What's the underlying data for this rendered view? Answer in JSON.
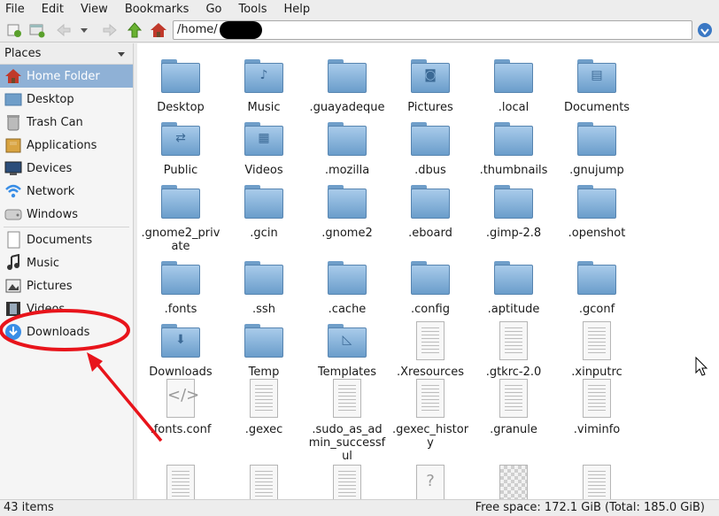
{
  "menubar": {
    "items": [
      "File",
      "Edit",
      "View",
      "Bookmarks",
      "Go",
      "Tools",
      "Help"
    ]
  },
  "toolbar": {
    "path": "/home/"
  },
  "sidebar": {
    "header": "Places",
    "group1": [
      {
        "label": "Home Folder",
        "icon": "home-icon",
        "selected": true
      },
      {
        "label": "Desktop",
        "icon": "desktop-icon"
      },
      {
        "label": "Trash Can",
        "icon": "trash-icon"
      },
      {
        "label": "Applications",
        "icon": "applications-icon"
      },
      {
        "label": "Devices",
        "icon": "devices-icon"
      },
      {
        "label": "Network",
        "icon": "network-icon"
      },
      {
        "label": "Windows",
        "icon": "drive-icon"
      }
    ],
    "group2": [
      {
        "label": "Documents",
        "icon": "document-icon"
      },
      {
        "label": "Music",
        "icon": "music-icon"
      },
      {
        "label": "Pictures",
        "icon": "pictures-icon"
      },
      {
        "label": "Videos",
        "icon": "videos-icon"
      },
      {
        "label": "Downloads",
        "icon": "downloads-icon"
      }
    ]
  },
  "files": [
    {
      "name": "Desktop",
      "kind": "folder",
      "emblem": ""
    },
    {
      "name": "Music",
      "kind": "folder",
      "emblem": "♪"
    },
    {
      "name": ".guayadeque",
      "kind": "folder",
      "emblem": ""
    },
    {
      "name": "Pictures",
      "kind": "folder",
      "emblem": "◙"
    },
    {
      "name": ".local",
      "kind": "folder",
      "emblem": ""
    },
    {
      "name": "Documents",
      "kind": "folder",
      "emblem": "▤"
    },
    {
      "name": "Public",
      "kind": "folder",
      "emblem": "⇄"
    },
    {
      "name": "Videos",
      "kind": "folder",
      "emblem": "▦"
    },
    {
      "name": ".mozilla",
      "kind": "folder",
      "emblem": ""
    },
    {
      "name": ".dbus",
      "kind": "folder",
      "emblem": ""
    },
    {
      "name": ".thumbnails",
      "kind": "folder",
      "emblem": ""
    },
    {
      "name": ".gnujump",
      "kind": "folder",
      "emblem": ""
    },
    {
      "name": ".gnome2_private",
      "kind": "folder",
      "emblem": ""
    },
    {
      "name": ".gcin",
      "kind": "folder",
      "emblem": ""
    },
    {
      "name": ".gnome2",
      "kind": "folder",
      "emblem": ""
    },
    {
      "name": ".eboard",
      "kind": "folder",
      "emblem": ""
    },
    {
      "name": ".gimp-2.8",
      "kind": "folder",
      "emblem": ""
    },
    {
      "name": ".openshot",
      "kind": "folder",
      "emblem": ""
    },
    {
      "name": ".fonts",
      "kind": "folder",
      "emblem": ""
    },
    {
      "name": ".ssh",
      "kind": "folder",
      "emblem": ""
    },
    {
      "name": ".cache",
      "kind": "folder",
      "emblem": ""
    },
    {
      "name": ".config",
      "kind": "folder",
      "emblem": ""
    },
    {
      "name": ".aptitude",
      "kind": "folder",
      "emblem": ""
    },
    {
      "name": ".gconf",
      "kind": "folder",
      "emblem": ""
    },
    {
      "name": "Downloads",
      "kind": "folder",
      "emblem": "⬇"
    },
    {
      "name": "Temp",
      "kind": "folder",
      "emblem": ""
    },
    {
      "name": "Templates",
      "kind": "folder",
      "emblem": "◺"
    },
    {
      "name": ".Xresources",
      "kind": "doc",
      "emblem": ""
    },
    {
      "name": ".gtkrc-2.0",
      "kind": "doc",
      "emblem": ""
    },
    {
      "name": ".xinputrc",
      "kind": "doc",
      "emblem": ""
    },
    {
      "name": ".fonts.conf",
      "kind": "code",
      "emblem": "</>"
    },
    {
      "name": ".gexec",
      "kind": "doc",
      "emblem": ""
    },
    {
      "name": ".sudo_as_admin_successful",
      "kind": "doc",
      "emblem": ""
    },
    {
      "name": ".gexec_history",
      "kind": "doc",
      "emblem": ""
    },
    {
      "name": ".granule",
      "kind": "doc",
      "emblem": ""
    },
    {
      "name": ".viminfo",
      "kind": "doc",
      "emblem": ""
    },
    {
      "name": "",
      "kind": "doc",
      "emblem": ""
    },
    {
      "name": "",
      "kind": "doc",
      "emblem": ""
    },
    {
      "name": "",
      "kind": "doc",
      "emblem": ""
    },
    {
      "name": "",
      "kind": "unknown",
      "emblem": "?"
    },
    {
      "name": "",
      "kind": "image",
      "emblem": ""
    },
    {
      "name": "",
      "kind": "doc",
      "emblem": ""
    }
  ],
  "statusbar": {
    "items": "43 items",
    "free_space": "Free space: 172.1 GiB (Total: 185.0 GiB)"
  },
  "colors": {
    "selection": "#8fb1d6",
    "annotation": "#e8141b",
    "folder": "#7aaad6"
  }
}
